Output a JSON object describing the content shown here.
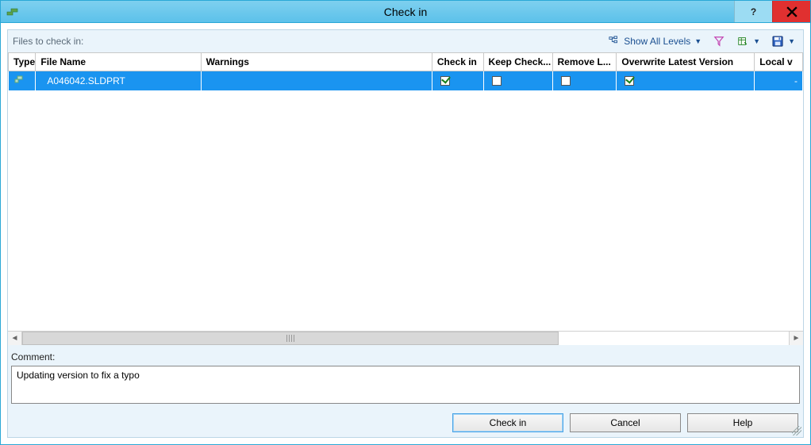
{
  "window": {
    "title": "Check in"
  },
  "toolbar": {
    "files_label": "Files to check in:",
    "show_all_levels": "Show All Levels"
  },
  "grid": {
    "headers": {
      "type": "Type",
      "file_name": "File Name",
      "warnings": "Warnings",
      "check_in": "Check in",
      "keep_checked_out": "Keep Check...",
      "remove_local": "Remove L...",
      "overwrite": "Overwrite Latest Version",
      "local_version": "Local v"
    },
    "rows": [
      {
        "file_name": "A046042.SLDPRT",
        "warnings": "",
        "check_in": true,
        "keep_checked_out": false,
        "remove_local": false,
        "overwrite": true,
        "local_version": "-"
      }
    ]
  },
  "comment": {
    "label": "Comment:",
    "value": "Updating version to fix a typo"
  },
  "footer": {
    "check_in": "Check in",
    "cancel": "Cancel",
    "help": "Help"
  }
}
